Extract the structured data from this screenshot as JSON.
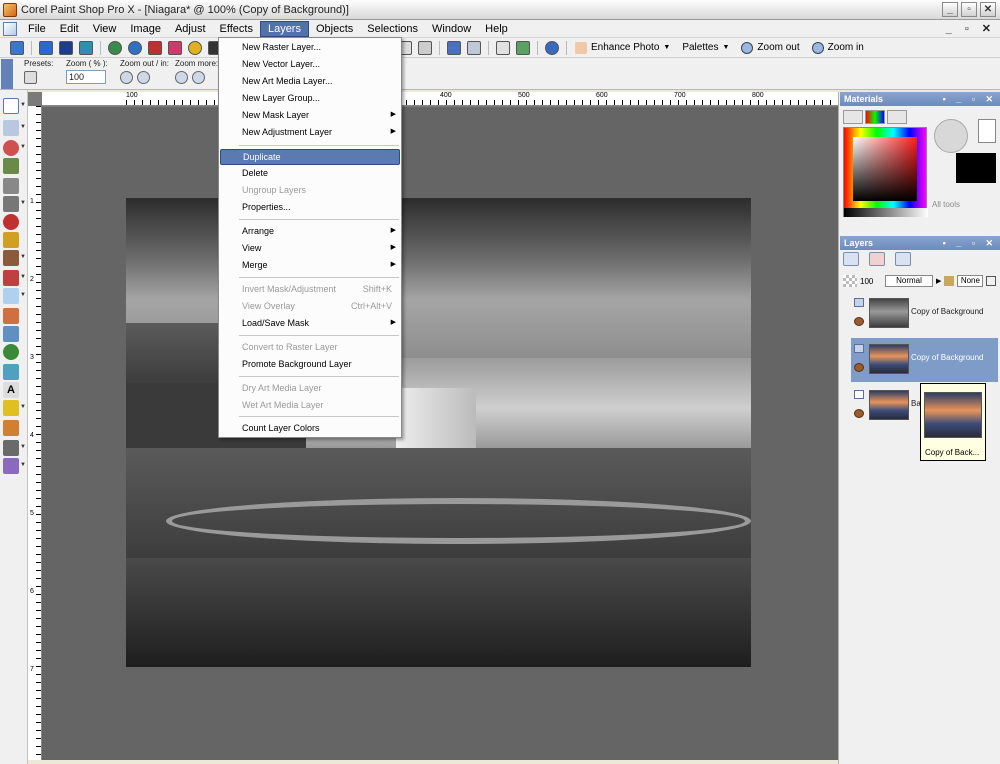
{
  "window": {
    "title": "Corel Paint Shop Pro X - [Niagara* @ 100% (Copy of Background)]",
    "controls": [
      "_",
      "▫",
      "✕"
    ]
  },
  "menubar": {
    "items": [
      "File",
      "Edit",
      "View",
      "Image",
      "Adjust",
      "Effects",
      "Layers",
      "Objects",
      "Selections",
      "Window",
      "Help"
    ],
    "active": "Layers",
    "doc_controls": "_ ▫ ✕"
  },
  "toolbar": {
    "enhance_photo": "Enhance Photo",
    "palettes": "Palettes",
    "zoom_out": "Zoom out",
    "zoom_in": "Zoom in"
  },
  "tool_options": {
    "presets_label": "Presets:",
    "zoom_label": "Zoom ( % ):",
    "zoom_value": "100",
    "zoom_out_in_label": "Zoom out / in:",
    "zoom_more_label": "Zoom more:"
  },
  "ruler": {
    "h_ticks": [
      "100",
      "400",
      "500",
      "600",
      "700",
      "800"
    ],
    "v_ticks": [
      "1",
      "2",
      "3",
      "4",
      "5",
      "6",
      "7",
      "8",
      "9"
    ]
  },
  "layers_menu": [
    {
      "label": "New Raster Layer...",
      "type": "item",
      "enabled": true,
      "submenu": false
    },
    {
      "label": "New Vector Layer...",
      "type": "item",
      "enabled": true,
      "submenu": false
    },
    {
      "label": "New Art Media Layer...",
      "type": "item",
      "enabled": true,
      "submenu": false
    },
    {
      "label": "New Layer Group...",
      "type": "item",
      "enabled": true,
      "submenu": false
    },
    {
      "label": "New Mask Layer",
      "type": "item",
      "enabled": true,
      "submenu": true
    },
    {
      "label": "New Adjustment Layer",
      "type": "item",
      "enabled": true,
      "submenu": true
    },
    {
      "label": "Duplicate",
      "type": "item",
      "enabled": true,
      "highlighted": true
    },
    {
      "label": "Delete",
      "type": "item",
      "enabled": true
    },
    {
      "label": "Ungroup Layers",
      "type": "item",
      "enabled": false
    },
    {
      "label": "Properties...",
      "type": "item",
      "enabled": true
    },
    {
      "label": "Arrange",
      "type": "item",
      "enabled": true,
      "submenu": true
    },
    {
      "label": "View",
      "type": "item",
      "enabled": true,
      "submenu": true
    },
    {
      "label": "Merge",
      "type": "item",
      "enabled": true,
      "submenu": true
    },
    {
      "label": "Invert Mask/Adjustment",
      "shortcut": "Shift+K",
      "type": "item",
      "enabled": false
    },
    {
      "label": "View Overlay",
      "shortcut": "Ctrl+Alt+V",
      "type": "item",
      "enabled": false
    },
    {
      "label": "Load/Save Mask",
      "type": "item",
      "enabled": true,
      "submenu": true
    },
    {
      "label": "Convert to Raster Layer",
      "type": "item",
      "enabled": false
    },
    {
      "label": "Promote Background Layer",
      "type": "item",
      "enabled": true
    },
    {
      "label": "Dry Art Media Layer",
      "type": "item",
      "enabled": false
    },
    {
      "label": "Wet Art Media Layer",
      "type": "item",
      "enabled": false
    },
    {
      "label": "Count Layer Colors",
      "type": "item",
      "enabled": true
    }
  ],
  "materials_panel": {
    "title": "Materials",
    "all_tools": "All tools"
  },
  "layers_panel": {
    "title": "Layers",
    "opacity": "100",
    "blend_mode": "Normal",
    "mask_mode": "None",
    "layers": [
      {
        "name": "Copy of Background",
        "selected": false,
        "thumb": "gray"
      },
      {
        "name": "Copy of Background",
        "selected": true,
        "thumb": "color"
      },
      {
        "name": "Background",
        "selected": false,
        "thumb": "color"
      }
    ],
    "tooltip": "Copy of Back..."
  },
  "colors": {
    "menu_highlight": "#5b7bb0",
    "panel_title": "#6c8bbf",
    "canvas_bg": "#656565"
  }
}
